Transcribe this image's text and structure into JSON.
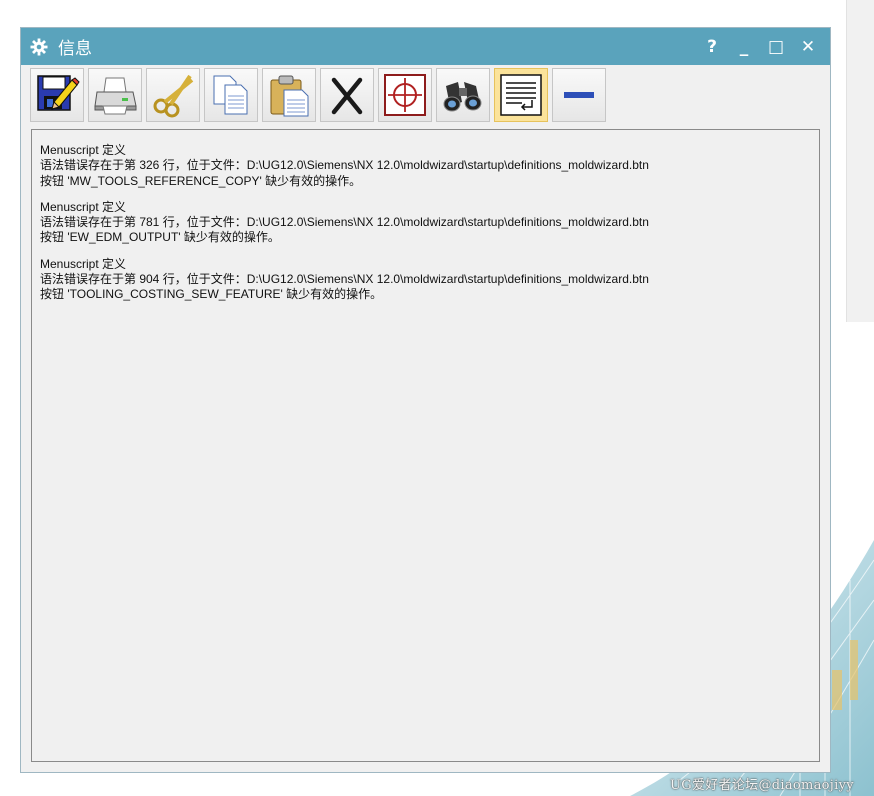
{
  "window": {
    "title": "信息",
    "help_label": "?",
    "minimize_label": "_",
    "maximize_label": "□",
    "close_label": "✕"
  },
  "toolbar": {
    "buttons": [
      {
        "icon": "save-edit-icon"
      },
      {
        "icon": "print-icon"
      },
      {
        "icon": "cut-icon"
      },
      {
        "icon": "copy-icon"
      },
      {
        "icon": "paste-icon"
      },
      {
        "icon": "delete-icon"
      },
      {
        "icon": "target-icon"
      },
      {
        "icon": "binoculars-icon"
      },
      {
        "icon": "word-wrap-icon",
        "active": true
      },
      {
        "icon": "minus-icon"
      }
    ]
  },
  "messages": [
    {
      "line1": "Menuscript 定义",
      "line2": "语法错误存在于第 326 行，位于文件：D:\\UG12.0\\Siemens\\NX 12.0\\moldwizard\\startup\\definitions_moldwizard.btn",
      "line3": "按钮 'MW_TOOLS_REFERENCE_COPY' 缺少有效的操作。"
    },
    {
      "line1": "Menuscript 定义",
      "line2": "语法错误存在于第 781 行，位于文件：D:\\UG12.0\\Siemens\\NX 12.0\\moldwizard\\startup\\definitions_moldwizard.btn",
      "line3": "按钮 'EW_EDM_OUTPUT' 缺少有效的操作。"
    },
    {
      "line1": "Menuscript 定义",
      "line2": "语法错误存在于第 904 行，位于文件：D:\\UG12.0\\Siemens\\NX 12.0\\moldwizard\\startup\\definitions_moldwizard.btn",
      "line3": "按钮 'TOOLING_COSTING_SEW_FEATURE' 缺少有效的操作。"
    }
  ],
  "watermark": "UG爱好者论坛@diaomaojiyy",
  "colors": {
    "titlebar": "#5aa3bc",
    "active_button": "#fbe39a",
    "content_bg": "#f0f0f0"
  }
}
